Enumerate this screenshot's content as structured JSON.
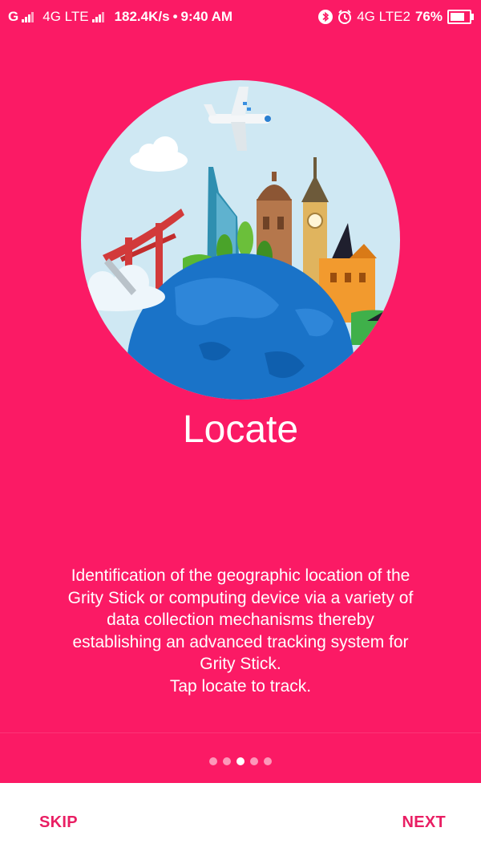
{
  "status_bar": {
    "carrier1": "G",
    "network": "4G LTE",
    "speed": "182.4K/s",
    "time": "9:40 AM",
    "network2": "4G LTE2",
    "battery": "76%",
    "battery_level": 0.76,
    "icons": [
      "signal-icon",
      "bluetooth-icon",
      "alarm-icon",
      "battery-icon"
    ]
  },
  "onboarding": {
    "title": "Locate",
    "description_lines": [
      "Identification of the geographic location of the",
      "Grity Stick or computing device via a variety of",
      "data collection mechanisms thereby",
      "establishing an advanced tracking system for",
      "Grity Stick.",
      "Tap locate to track."
    ],
    "page_count": 5,
    "active_page": 3
  },
  "footer": {
    "skip_label": "SKIP",
    "next_label": "NEXT"
  },
  "colors": {
    "background": "#fb1a65",
    "accent": "#e91e63",
    "sky": "#cfe8f3",
    "ocean": "#1a73c8"
  }
}
